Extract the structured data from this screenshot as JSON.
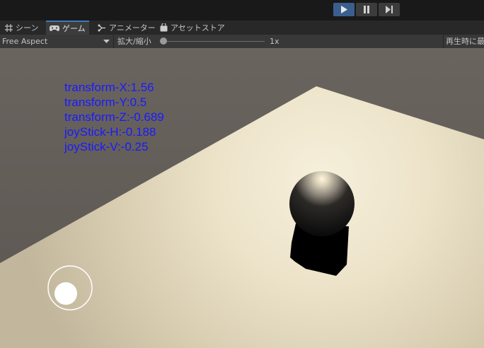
{
  "playbar": {
    "buttons": [
      {
        "name": "play",
        "active": true
      },
      {
        "name": "pause",
        "active": false
      },
      {
        "name": "step",
        "active": false
      }
    ]
  },
  "tabs": [
    {
      "label": "シーン",
      "icon": "grid-icon",
      "active": false
    },
    {
      "label": "ゲーム",
      "icon": "gamepad-icon",
      "active": true
    },
    {
      "label": "アニメーター",
      "icon": "animator-icon",
      "active": false
    },
    {
      "label": "アセットストア",
      "icon": "bag-icon",
      "active": false
    }
  ],
  "controls": {
    "aspect": "Free Aspect",
    "zoom_label": "拡大/縮小",
    "zoom_value": "1x",
    "zoom_fraction": 0,
    "play_focus": "再生時に最"
  },
  "hud": {
    "lines": [
      "transform-X:1.56",
      "transform-Y:0.5",
      "transform-Z:-0.689",
      "joyStick-H:-0.188",
      "joyStick-V:-0.25"
    ],
    "color": "#1a1aff"
  },
  "scene": {
    "sky_color": "#5f5a55",
    "ground_color": "#f3ecd7",
    "ball_color": "#1a1a1a"
  }
}
